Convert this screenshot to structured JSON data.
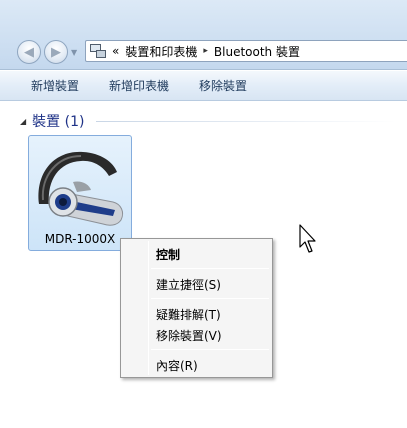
{
  "address_bar": {
    "overflow_chevron": "«",
    "crumb_separator": "▸",
    "breadcrumbs": [
      "裝置和印表機",
      "Bluetooth 裝置"
    ]
  },
  "command_bar": {
    "add_device": "新增裝置",
    "add_printer": "新增印表機",
    "remove_device": "移除裝置"
  },
  "group": {
    "collapse_glyph": "◢",
    "title": "裝置 (1)"
  },
  "device": {
    "name": "MDR-1000X",
    "icon": "headset-icon"
  },
  "context_menu": {
    "items": [
      "控制",
      "建立捷徑(S)",
      "疑難排解(T)",
      "移除裝置(V)",
      "內容(R)"
    ]
  },
  "colors": {
    "selection_fill": "#cde4f8",
    "selection_border": "#84acdd",
    "link_text": "#1e3287"
  }
}
